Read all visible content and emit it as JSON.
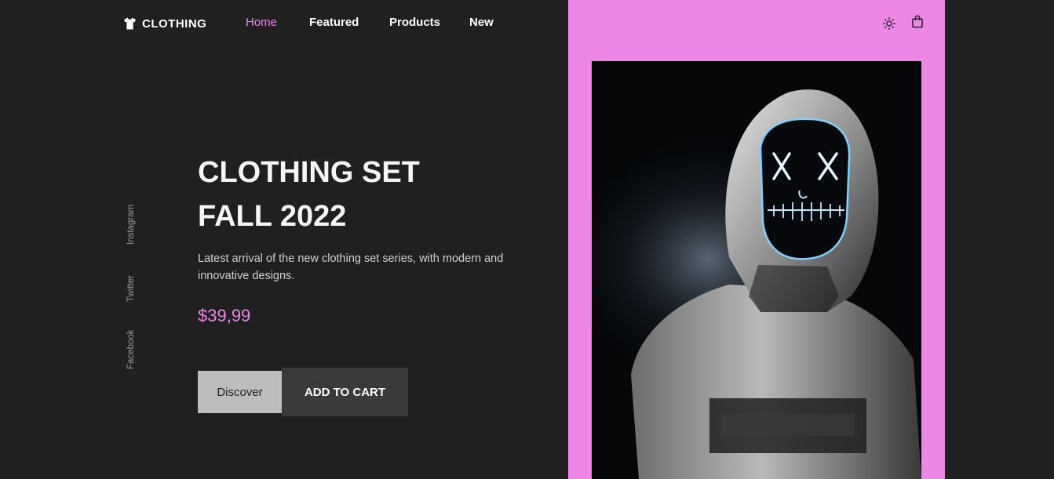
{
  "brand": {
    "name": "CLOTHING",
    "icon": "tshirt-icon"
  },
  "nav": {
    "items": [
      {
        "label": "Home",
        "active": true
      },
      {
        "label": "Featured",
        "active": false
      },
      {
        "label": "Products",
        "active": false
      },
      {
        "label": "New",
        "active": false
      }
    ]
  },
  "header_actions": {
    "theme_icon": "sun-icon",
    "cart_icon": "shopping-bag-icon"
  },
  "social": [
    "Instagram",
    "Twitter",
    "Facebook"
  ],
  "hero": {
    "title_line1": "CLOTHING SET",
    "title_line2": "FALL 2022",
    "description": "Latest arrival of the new clothing set series, with modern and innovative designs.",
    "price": "$39,99",
    "discover_label": "Discover",
    "cart_label": "ADD TO CART"
  },
  "colors": {
    "background": "#202020",
    "accent": "#ec87e6",
    "discover_bg": "#bdbdbd",
    "cart_bg": "#3a3a3a"
  }
}
